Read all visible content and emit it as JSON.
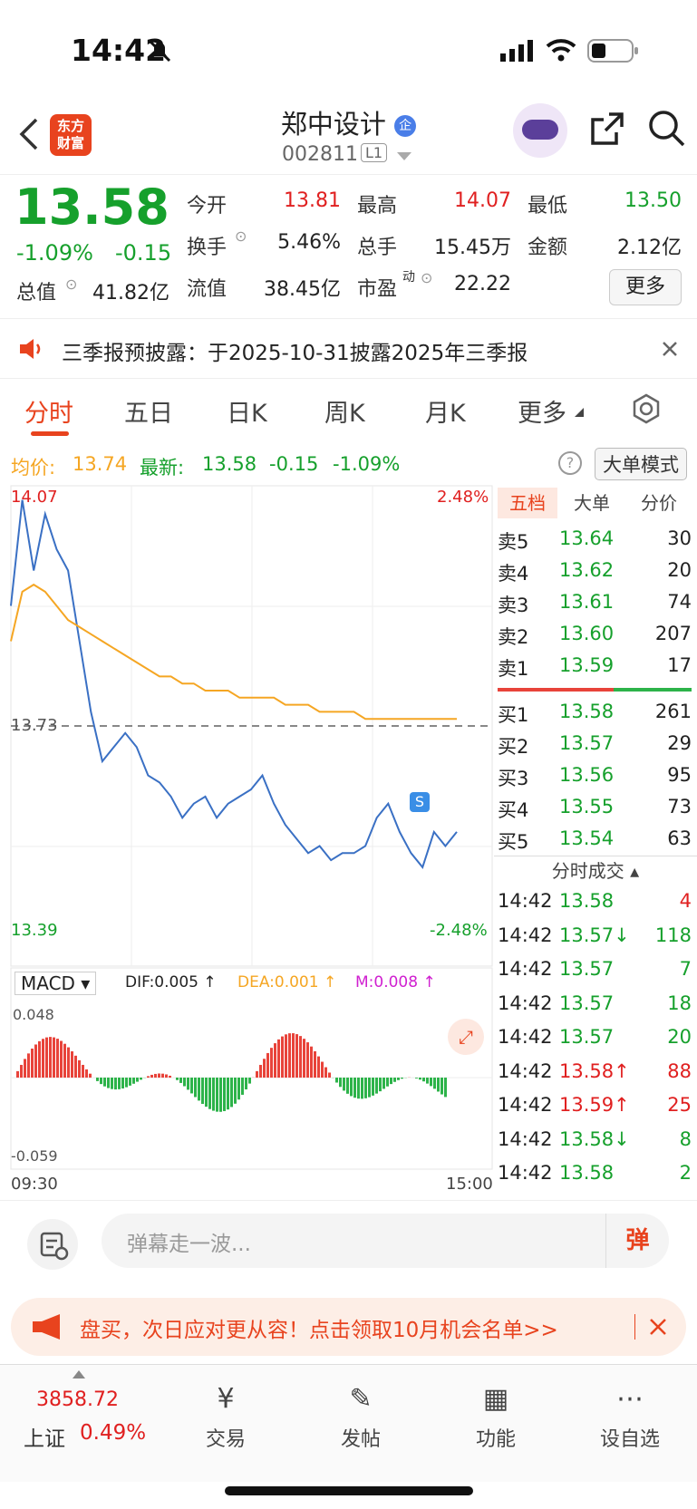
{
  "status": {
    "time": "14:42"
  },
  "header": {
    "logo_line1": "东方",
    "logo_line2": "财富",
    "title": "郑中设计",
    "badge": "企",
    "code": "002811",
    "level": "L1"
  },
  "quote": {
    "price": "13.58",
    "change_pct": "-1.09%",
    "change": "-0.15",
    "open_label": "今开",
    "open": "13.81",
    "high_label": "最高",
    "high": "14.07",
    "low_label": "最低",
    "low": "13.50",
    "turnover_label": "换手",
    "turnover": "5.46%",
    "volume_label": "总手",
    "volume": "15.45万",
    "amount_label": "金额",
    "amount": "2.12亿",
    "mcap_label": "总值",
    "mcap": "41.82亿",
    "float_label": "流值",
    "float": "38.45亿",
    "pe_label": "市盈",
    "pe_sup": "动",
    "pe": "22.22",
    "more": "更多"
  },
  "notice": {
    "text": "三季报预披露：于2025-10-31披露2025年三季报"
  },
  "tabs": [
    "分时",
    "五日",
    "日K",
    "周K",
    "月K",
    "更多"
  ],
  "info": {
    "avg_label": "均价:",
    "avg": "13.74",
    "latest_label": "最新:",
    "latest": "13.58",
    "chg": "-0.15",
    "pct": "-1.09%",
    "mode_btn": "大单模式"
  },
  "chart": {
    "top_price": "14.07",
    "top_pct": "2.48%",
    "mid_price": "13.73",
    "bottom_price": "13.39",
    "bottom_pct": "-2.48%",
    "macd_label": "MACD",
    "dif": "DIF:0.005 ↑",
    "dea": "DEA:0.001 ↑",
    "m": "M:0.008 ↑",
    "macd_top": "0.048",
    "macd_bottom": "-0.059",
    "time_start": "09:30",
    "time_end": "15:00",
    "marker": "S"
  },
  "chart_data": {
    "type": "line",
    "title": "",
    "ylim": [
      13.39,
      14.07
    ],
    "x": [
      "09:30",
      "15:00"
    ],
    "series": [
      {
        "name": "price",
        "values": [
          13.9,
          14.05,
          13.95,
          14.03,
          13.98,
          13.95,
          13.85,
          13.75,
          13.68,
          13.7,
          13.72,
          13.7,
          13.66,
          13.65,
          13.63,
          13.6,
          13.62,
          13.63,
          13.6,
          13.62,
          13.63,
          13.64,
          13.66,
          13.62,
          13.59,
          13.57,
          13.55,
          13.56,
          13.54,
          13.55,
          13.55,
          13.56,
          13.6,
          13.62,
          13.58,
          13.55,
          13.53,
          13.58,
          13.56,
          13.58
        ]
      },
      {
        "name": "均价",
        "values": [
          13.85,
          13.92,
          13.93,
          13.92,
          13.9,
          13.88,
          13.87,
          13.86,
          13.85,
          13.84,
          13.83,
          13.82,
          13.81,
          13.8,
          13.8,
          13.79,
          13.79,
          13.78,
          13.78,
          13.78,
          13.77,
          13.77,
          13.77,
          13.77,
          13.76,
          13.76,
          13.76,
          13.75,
          13.75,
          13.75,
          13.75,
          13.74,
          13.74,
          13.74,
          13.74,
          13.74,
          13.74,
          13.74,
          13.74,
          13.74
        ]
      }
    ]
  },
  "book_tabs": [
    "五档",
    "大单",
    "分价"
  ],
  "asks": [
    {
      "l": "卖5",
      "p": "13.64",
      "v": "30"
    },
    {
      "l": "卖4",
      "p": "13.62",
      "v": "20"
    },
    {
      "l": "卖3",
      "p": "13.61",
      "v": "74"
    },
    {
      "l": "卖2",
      "p": "13.60",
      "v": "207"
    },
    {
      "l": "卖1",
      "p": "13.59",
      "v": "17"
    }
  ],
  "bids": [
    {
      "l": "买1",
      "p": "13.58",
      "v": "261"
    },
    {
      "l": "买2",
      "p": "13.57",
      "v": "29"
    },
    {
      "l": "买3",
      "p": "13.56",
      "v": "95"
    },
    {
      "l": "买4",
      "p": "13.55",
      "v": "73"
    },
    {
      "l": "买5",
      "p": "13.54",
      "v": "63"
    }
  ],
  "ticks_title": "分时成交",
  "ticks": [
    {
      "t": "14:42",
      "p": "13.58",
      "v": "4",
      "c": "red"
    },
    {
      "t": "14:42",
      "p": "13.57↓",
      "v": "118",
      "c": "green"
    },
    {
      "t": "14:42",
      "p": "13.57",
      "v": "7",
      "c": "green"
    },
    {
      "t": "14:42",
      "p": "13.57",
      "v": "18",
      "c": "green"
    },
    {
      "t": "14:42",
      "p": "13.57",
      "v": "20",
      "c": "green"
    },
    {
      "t": "14:42",
      "p": "13.58↑",
      "v": "88",
      "c": "red"
    },
    {
      "t": "14:42",
      "p": "13.59↑",
      "v": "25",
      "c": "red"
    },
    {
      "t": "14:42",
      "p": "13.58↓",
      "v": "8",
      "c": "green"
    },
    {
      "t": "14:42",
      "p": "13.58",
      "v": "2",
      "c": "green"
    }
  ],
  "danmu": {
    "placeholder": "弹幕走一波...",
    "send": "弹"
  },
  "ad": {
    "text": "盘买，次日应对更从容！点击领取10月机会名单>>"
  },
  "nav": {
    "index_value": "3858.72",
    "index_name": "上证",
    "index_pct": "0.49%",
    "items": [
      "交易",
      "发帖",
      "功能",
      "设自选"
    ]
  }
}
